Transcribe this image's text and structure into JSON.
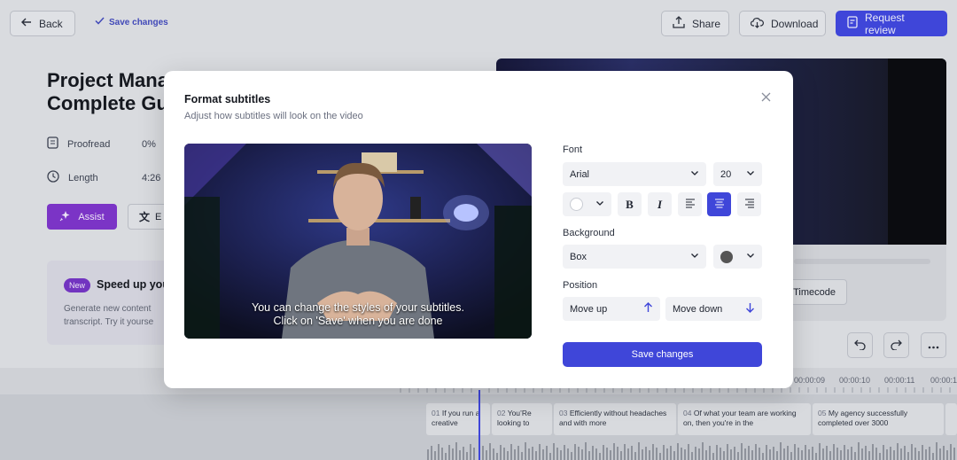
{
  "toolbar": {
    "back_label": "Back",
    "save_status": "Save changes",
    "share_label": "Share",
    "download_label": "Download",
    "request_review_label": "Request review"
  },
  "project": {
    "title_line1": "Project Mana",
    "title_line2": "Complete Gu",
    "proofread_label": "Proofread",
    "proofread_value": "0%",
    "length_label": "Length",
    "length_value": "4:26",
    "assist_label": "Assist",
    "translate_label": "E"
  },
  "promo": {
    "badge": "New",
    "title": "Speed up you",
    "text_line1": "Generate new content",
    "text_line2": "transcript. Try it yourse"
  },
  "player": {
    "timecode_label": "Timecode"
  },
  "timeline": {
    "ticks": [
      "00:00:09",
      "00:00:10",
      "00:00:11",
      "00:00:1"
    ],
    "segments": [
      {
        "num": "01",
        "text": "If you run a creative"
      },
      {
        "num": "02",
        "text": "You’Re looking to"
      },
      {
        "num": "03",
        "text": "Efficiently without headaches and with more"
      },
      {
        "num": "04",
        "text": "Of what your team are working on, then you're in the"
      },
      {
        "num": "05",
        "text": "My agency successfully completed over 3000"
      }
    ]
  },
  "modal": {
    "title": "Format subtitles",
    "subtitle": "Adjust how subtitles will look on the video",
    "preview_caption_line1": "You can change the styles of your subtitles.",
    "preview_caption_line2": "Click on 'Save' when you are done",
    "font_label": "Font",
    "font_value": "Arial",
    "size_value": "20",
    "text_color": "#ffffff",
    "bold_label": "B",
    "italic_label": "I",
    "align_selected": "center",
    "background_label": "Background",
    "background_value": "Box",
    "background_color": "#555555",
    "position_label": "Position",
    "move_up_label": "Move up",
    "move_down_label": "Move down",
    "save_label": "Save changes"
  },
  "colors": {
    "primary": "#3f46d9",
    "assist": "#7b34c6"
  }
}
